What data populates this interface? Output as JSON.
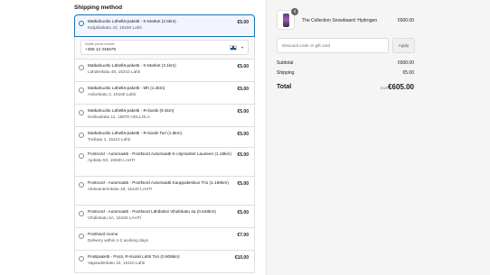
{
  "shipping": {
    "title": "Shipping method",
    "selected": {
      "name": "Matkahuolto Lähellä-paketti - K-Market (2.5km)",
      "address": "Karjalankatu 43, 15150 Lahti",
      "price": "€5.00"
    },
    "phone": {
      "label": "Mobile phone number",
      "value": "+358 12 345678",
      "country": "FI"
    },
    "options": [
      {
        "name": "Matkahuolto Lähellä-paketti - K-Market (3.1km)",
        "address": "Lahdenkatu 48, 15210 Lahti",
        "price": "€5.00"
      },
      {
        "name": "Matkahuolto Lähellä-paketti - Mh (1.4km)",
        "address": "Askonkatu 2, 15100 Lahti",
        "price": "€5.00"
      },
      {
        "name": "Matkahuolto Lähellä-paketti - R-kioski (9.4km)",
        "address": "Keskuskatu 11, 15870 HOLLOLA",
        "price": "€5.00"
      },
      {
        "name": "Matkahuolto Lähellä-paketti - R-kioski Tori (1.5km)",
        "address": "Torikatu 1, 15110 Lahti",
        "price": "€5.00"
      },
      {
        "name": "Postnord - Automaatti - PostNord Automaatti K-citymarket Launeen (1.18km)",
        "address": "Ajokatu 53, 15500 LAHTI",
        "price": "€5.00"
      },
      {
        "name": "Postnord - Automaatti - PostNord Automaatti Kauppakeskus Trio (1.166km)",
        "address": "Aleksanterinkatu 18, 15140 LAHTI",
        "price": "€5.00"
      },
      {
        "name": "Postnord - Automaatti - PostNord Lähiboksi Vihdinkatu 4a (0.648km)",
        "address": "Vihdinkatu 4A, 15160 LAHTI",
        "price": "€5.00"
      },
      {
        "name": "PostNord Home",
        "address": "Delivery within 1-2 working days",
        "price": "€7.00"
      },
      {
        "name": "Postipaketti - Posti, R-Kioski Lahti Tori (0.908km)",
        "address": "Vapaudenkatu 10, 15110 Lahti",
        "price": "€10.00"
      }
    ]
  },
  "summary": {
    "product": {
      "name": "The Collection Snowboard: Hydrogen",
      "quantity": "4",
      "price": "€600.00"
    },
    "discount": {
      "placeholder": "Discount code or gift card",
      "apply_label": "Apply"
    },
    "subtotal_label": "Subtotal",
    "subtotal_value": "€600.00",
    "shipping_label": "Shipping",
    "shipping_value": "€5.00",
    "total_label": "Total",
    "currency": "EUR",
    "total_value": "€605.00"
  },
  "colors": {
    "accent": "#1773b0",
    "summary_bg": "#f5f5f5"
  }
}
